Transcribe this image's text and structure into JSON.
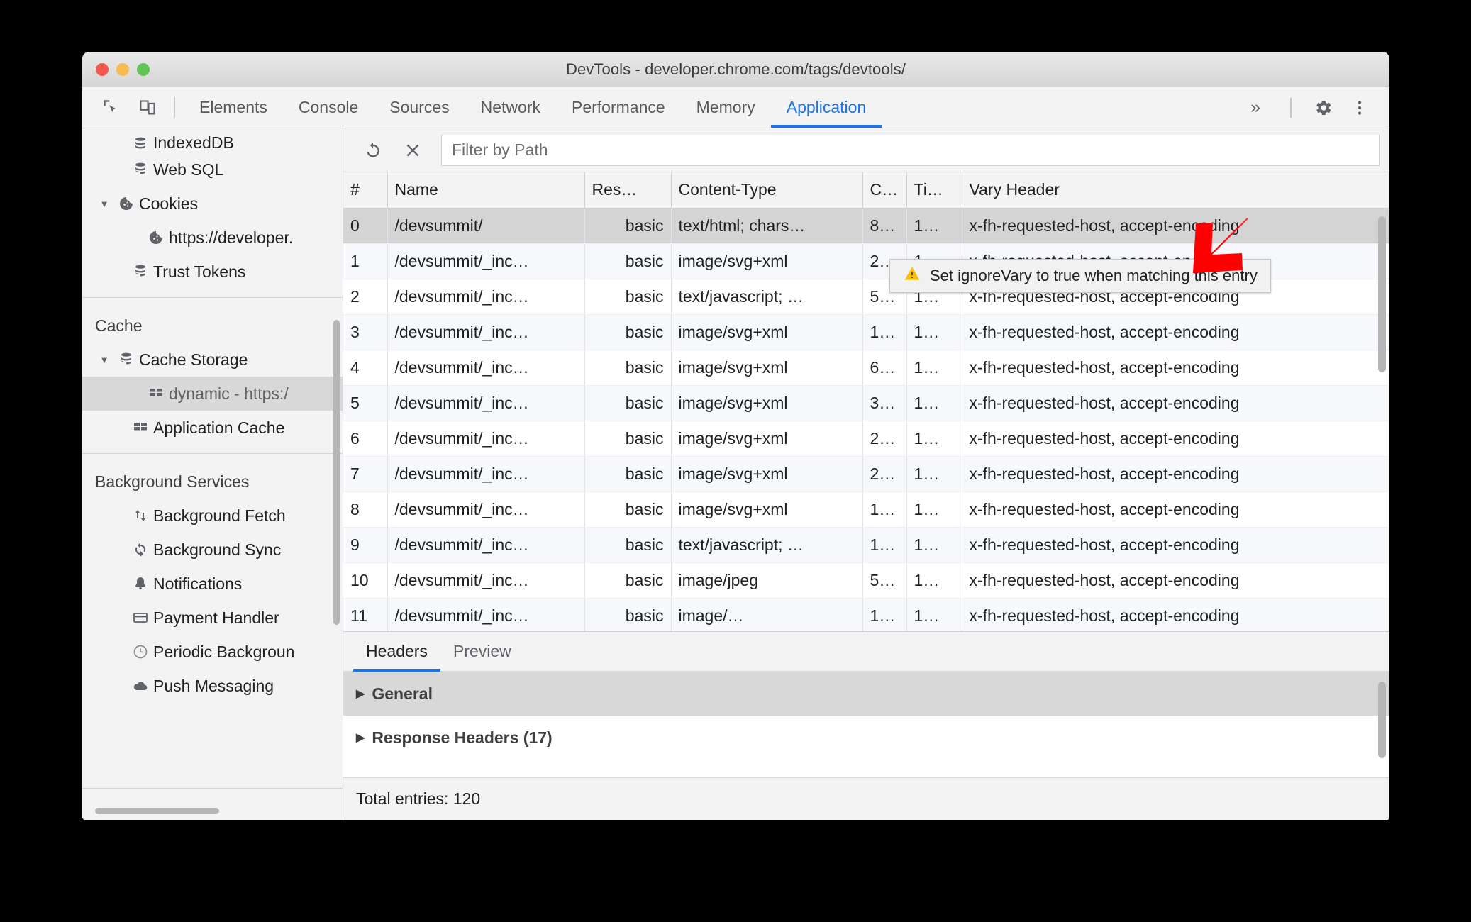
{
  "window": {
    "title": "DevTools - developer.chrome.com/tags/devtools/"
  },
  "toolbar_icons": {
    "inspect": "inspect-element-icon",
    "device": "device-toolbar-icon",
    "more_tabs": "»",
    "settings": "gear-icon",
    "menu": "kebab-menu-icon"
  },
  "tabs": [
    {
      "label": "Elements",
      "active": false
    },
    {
      "label": "Console",
      "active": false
    },
    {
      "label": "Sources",
      "active": false
    },
    {
      "label": "Network",
      "active": false
    },
    {
      "label": "Performance",
      "active": false
    },
    {
      "label": "Memory",
      "active": false
    },
    {
      "label": "Application",
      "active": true
    }
  ],
  "sidebar": {
    "storage_items": [
      {
        "label": "IndexedDB",
        "icon": "database-icon",
        "indent": "indent-2",
        "arrow": "",
        "selected": false,
        "clipped": true
      },
      {
        "label": "Web SQL",
        "icon": "database-icon",
        "indent": "indent-2",
        "arrow": "",
        "selected": false
      },
      {
        "label": "Cookies",
        "icon": "cookie-icon",
        "indent": "indent-1",
        "arrow": "▼",
        "selected": false
      },
      {
        "label": "https://developer.",
        "icon": "cookie-icon",
        "indent": "indent-3",
        "arrow": "",
        "selected": false
      },
      {
        "label": "Trust Tokens",
        "icon": "database-icon",
        "indent": "indent-2",
        "arrow": "",
        "selected": false
      }
    ],
    "cache_section_title": "Cache",
    "cache_items": [
      {
        "label": "Cache Storage",
        "icon": "database-icon",
        "indent": "indent-1",
        "arrow": "▼",
        "selected": false
      },
      {
        "label": "dynamic - https:/",
        "icon": "grid-icon",
        "indent": "indent-3",
        "arrow": "",
        "selected": true
      },
      {
        "label": "Application Cache",
        "icon": "grid-icon",
        "indent": "indent-2",
        "arrow": "",
        "selected": false
      }
    ],
    "background_section_title": "Background Services",
    "background_items": [
      {
        "label": "Background Fetch",
        "icon": "updown-arrows-icon",
        "indent": "indent-2",
        "arrow": "",
        "selected": false
      },
      {
        "label": "Background Sync",
        "icon": "sync-icon",
        "indent": "indent-2",
        "arrow": "",
        "selected": false
      },
      {
        "label": "Notifications",
        "icon": "bell-icon",
        "indent": "indent-2",
        "arrow": "",
        "selected": false
      },
      {
        "label": "Payment Handler",
        "icon": "credit-card-icon",
        "indent": "indent-2",
        "arrow": "",
        "selected": false
      },
      {
        "label": "Periodic Backgroun",
        "icon": "clock-icon",
        "indent": "indent-2",
        "arrow": "",
        "selected": false
      },
      {
        "label": "Push Messaging",
        "icon": "cloud-icon",
        "indent": "indent-2",
        "arrow": "",
        "selected": false
      }
    ]
  },
  "cache_toolbar": {
    "refresh_icon": "refresh-icon",
    "delete_icon": "delete-x-icon",
    "filter_placeholder": "Filter by Path",
    "filter_value": ""
  },
  "table": {
    "columns": [
      "#",
      "Name",
      "Res…",
      "Content-Type",
      "C…",
      "Ti…",
      "Vary Header"
    ],
    "rows": [
      {
        "idx": "0",
        "name": "/devsummit/",
        "res": "basic",
        "ctype": "text/html; chars…",
        "len": "8…",
        "time": "1…",
        "vary": "x-fh-requested-host, accept-encoding",
        "selected": true
      },
      {
        "idx": "1",
        "name": "/devsummit/_inc…",
        "res": "basic",
        "ctype": "image/svg+xml",
        "len": "2…",
        "time": "1…",
        "vary": "x-fh-requested-host, accept-encoding",
        "selected": false
      },
      {
        "idx": "2",
        "name": "/devsummit/_inc…",
        "res": "basic",
        "ctype": "text/javascript; …",
        "len": "5…",
        "time": "1…",
        "vary": "x-fh-requested-host, accept-encoding",
        "selected": false
      },
      {
        "idx": "3",
        "name": "/devsummit/_inc…",
        "res": "basic",
        "ctype": "image/svg+xml",
        "len": "1…",
        "time": "1…",
        "vary": "x-fh-requested-host, accept-encoding",
        "selected": false
      },
      {
        "idx": "4",
        "name": "/devsummit/_inc…",
        "res": "basic",
        "ctype": "image/svg+xml",
        "len": "6…",
        "time": "1…",
        "vary": "x-fh-requested-host, accept-encoding",
        "selected": false
      },
      {
        "idx": "5",
        "name": "/devsummit/_inc…",
        "res": "basic",
        "ctype": "image/svg+xml",
        "len": "3…",
        "time": "1…",
        "vary": "x-fh-requested-host, accept-encoding",
        "selected": false
      },
      {
        "idx": "6",
        "name": "/devsummit/_inc…",
        "res": "basic",
        "ctype": "image/svg+xml",
        "len": "2…",
        "time": "1…",
        "vary": "x-fh-requested-host, accept-encoding",
        "selected": false
      },
      {
        "idx": "7",
        "name": "/devsummit/_inc…",
        "res": "basic",
        "ctype": "image/svg+xml",
        "len": "2…",
        "time": "1…",
        "vary": "x-fh-requested-host, accept-encoding",
        "selected": false
      },
      {
        "idx": "8",
        "name": "/devsummit/_inc…",
        "res": "basic",
        "ctype": "image/svg+xml",
        "len": "1…",
        "time": "1…",
        "vary": "x-fh-requested-host, accept-encoding",
        "selected": false
      },
      {
        "idx": "9",
        "name": "/devsummit/_inc…",
        "res": "basic",
        "ctype": "text/javascript; …",
        "len": "1…",
        "time": "1…",
        "vary": "x-fh-requested-host, accept-encoding",
        "selected": false
      },
      {
        "idx": "10",
        "name": "/devsummit/_inc…",
        "res": "basic",
        "ctype": "image/jpeg",
        "len": "5…",
        "time": "1…",
        "vary": "x-fh-requested-host, accept-encoding",
        "selected": false
      },
      {
        "idx": "11",
        "name": "/devsummit/_inc…",
        "res": "basic",
        "ctype": "image/…",
        "len": "1…",
        "time": "1…",
        "vary": "x-fh-requested-host, accept-encoding",
        "selected": false
      }
    ]
  },
  "tooltip": {
    "icon": "warning-triangle-icon",
    "text": "Set ignoreVary to true when matching this entry"
  },
  "detail": {
    "tabs": [
      {
        "label": "Headers",
        "active": true
      },
      {
        "label": "Preview",
        "active": false
      }
    ],
    "sections": [
      {
        "label": "General",
        "shaded": true
      },
      {
        "label": "Response Headers (17)",
        "shaded": false
      }
    ],
    "status": "Total entries: 120"
  },
  "annotation": {
    "arrow_color": "#ff0000",
    "points_at": "Vary Header"
  }
}
